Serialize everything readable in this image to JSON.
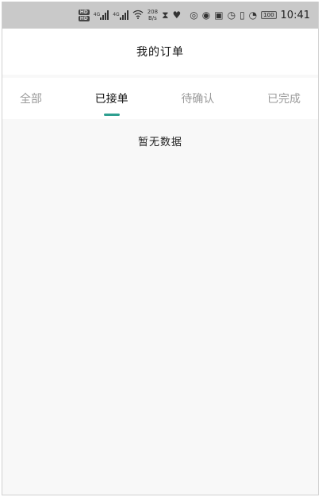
{
  "status_bar": {
    "hd1": "HD",
    "hd2": "HD",
    "net1": "4G",
    "net2": "4G",
    "speed_value": "208",
    "speed_unit": "B/s",
    "battery": "100",
    "time": "10:41"
  },
  "header": {
    "title": "我的订单"
  },
  "tabs": [
    {
      "label": "全部",
      "active": false
    },
    {
      "label": "已接单",
      "active": true
    },
    {
      "label": "待确认",
      "active": false
    },
    {
      "label": "已完成",
      "active": false
    }
  ],
  "empty_state": {
    "message": "暂无数据"
  },
  "colors": {
    "accent": "#2e9f90",
    "status_bar_bg": "#c9c9c9",
    "page_bg": "#f8f8f8"
  },
  "icons": [
    "hd-icon",
    "signal-icon",
    "wifi-icon",
    "hourglass-icon",
    "heart-icon",
    "data-saver-icon",
    "eye-icon",
    "nfc-icon",
    "alarm-icon",
    "vibrate-icon",
    "speedometer-icon",
    "battery-icon"
  ]
}
